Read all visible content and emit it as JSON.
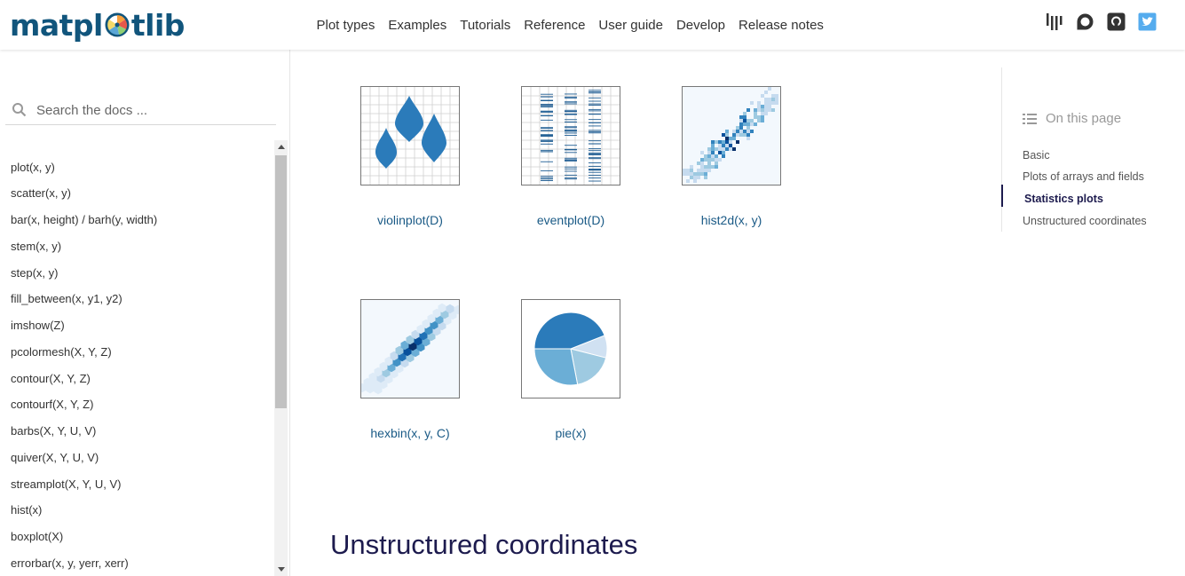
{
  "brand": {
    "logo_text_start": "matpl",
    "logo_text_end": "tlib"
  },
  "nav": [
    "Plot types",
    "Examples",
    "Tutorials",
    "Reference",
    "User guide",
    "Develop",
    "Release notes"
  ],
  "header_icons": [
    "gitter-icon",
    "discourse-icon",
    "github-icon",
    "twitter-icon"
  ],
  "search": {
    "placeholder": "Search the docs ..."
  },
  "sidebar": {
    "items": [
      "plot(x, y)",
      "scatter(x, y)",
      "bar(x, height) / barh(y, width)",
      "stem(x, y)",
      "step(x, y)",
      "fill_between(x, y1, y2)",
      "imshow(Z)",
      "pcolormesh(X, Y, Z)",
      "contour(X, Y, Z)",
      "contourf(X, Y, Z)",
      "barbs(X, Y, U, V)",
      "quiver(X, Y, U, V)",
      "streamplot(X, Y, U, V)",
      "hist(x)",
      "boxplot(X)",
      "errorbar(x, y, yerr, xerr)"
    ]
  },
  "gallery": {
    "items": [
      {
        "label": "violinplot(D)",
        "thumb": "violin"
      },
      {
        "label": "eventplot(D)",
        "thumb": "event"
      },
      {
        "label": "hist2d(x, y)",
        "thumb": "hist2d"
      },
      {
        "label": "hexbin(x, y, C)",
        "thumb": "hexbin"
      },
      {
        "label": "pie(x)",
        "thumb": "pie"
      }
    ]
  },
  "section_title": "Unstructured coordinates",
  "toc": {
    "heading": "On this page",
    "items": [
      "Basic",
      "Plots of arrays and fields",
      "Statistics plots",
      "Unstructured coordinates"
    ],
    "active": "Statistics plots"
  },
  "colors": {
    "accent": "#11557c",
    "heading": "#1d1b4e",
    "link": "#1a5a86",
    "plot_blue": "#2b7bba"
  }
}
